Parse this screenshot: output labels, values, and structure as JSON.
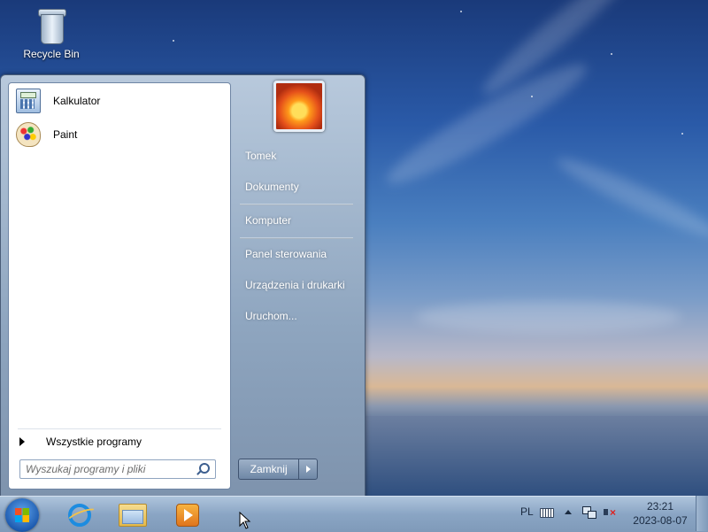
{
  "desktop": {
    "icons": [
      {
        "label": "Recycle Bin",
        "icon": "recycle-bin-icon"
      }
    ]
  },
  "start_menu": {
    "pinned_programs": [
      {
        "label": "Kalkulator",
        "icon": "calculator-icon"
      },
      {
        "label": "Paint",
        "icon": "paint-icon"
      }
    ],
    "all_programs_label": "Wszystkie programy",
    "search": {
      "placeholder": "Wyszukaj programy i pliki",
      "value": ""
    },
    "user_picture": "flower-avatar",
    "right_links": [
      "Tomek",
      "Dokumenty",
      "Komputer",
      "Panel sterowania",
      "Urządzenia i drukarki",
      "Uruchom..."
    ],
    "shutdown_label": "Zamknij"
  },
  "taskbar": {
    "pinned": [
      "internet-explorer-icon",
      "windows-explorer-icon",
      "media-player-icon"
    ],
    "tray": {
      "language": "PL",
      "time": "23:21",
      "date": "2023-08-07"
    }
  }
}
